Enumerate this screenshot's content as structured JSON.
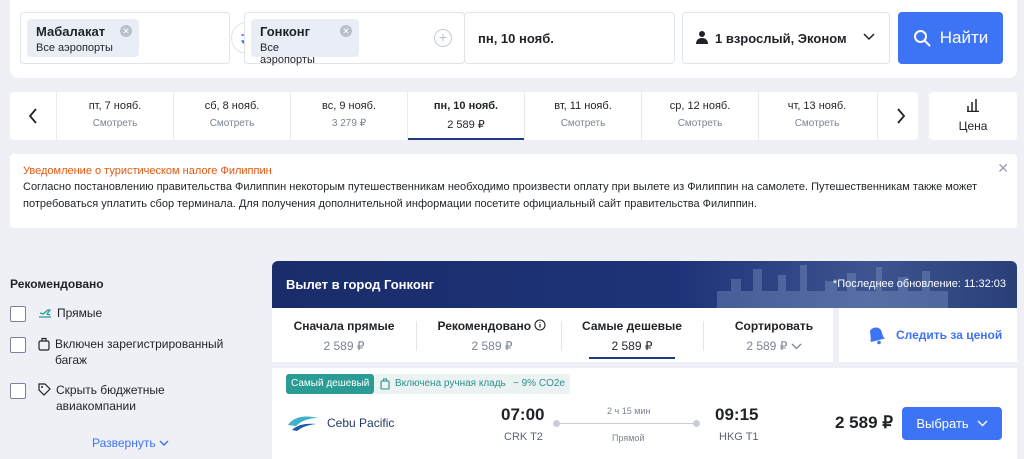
{
  "search": {
    "origin": {
      "city": "Мабалакат",
      "airports": "Все аэропорты"
    },
    "destination": {
      "city": "Гонконг",
      "airports": "Все аэропорты"
    },
    "date": "пн, 10 нояб.",
    "passengers": "1 взрослый, Эконом",
    "find_label": "Найти"
  },
  "date_strip": {
    "days": [
      {
        "date": "пт, 7 нояб.",
        "value": "Смотреть"
      },
      {
        "date": "сб, 8 нояб.",
        "value": "Смотреть"
      },
      {
        "date": "вс, 9 нояб.",
        "value": "3 279 ₽"
      },
      {
        "date": "пн, 10 нояб.",
        "value": "2 589 ₽",
        "selected": true
      },
      {
        "date": "вт, 11 нояб.",
        "value": "Смотреть"
      },
      {
        "date": "ср, 12 нояб.",
        "value": "Смотреть"
      },
      {
        "date": "чт, 13 нояб.",
        "value": "Смотреть"
      }
    ],
    "price_label": "Цена"
  },
  "notice": {
    "title": "Уведомление о туристическом налоге Филиппин",
    "body": "Согласно постановлению правительства Филиппин некоторым путешественникам необходимо произвести оплату при вылете из Филиппин на самолете. Путешественникам также может потребоваться уплатить сбор терминала. Для получения дополнительной информации посетите официальный сайт правительства Филиппин."
  },
  "sidebar": {
    "title": "Рекомендовано",
    "filters": [
      {
        "label": "Прямые",
        "icon": "direct-flight-icon"
      },
      {
        "label": "Включен зарегистрированный багаж",
        "icon": "luggage-icon"
      },
      {
        "label": "Скрыть бюджетные авиакомпании",
        "icon": "tag-icon"
      }
    ],
    "expand_label": "Развернуть"
  },
  "results": {
    "title": "Вылет в город Гонконг",
    "updated": "*Последнее обновление: 11:32:03",
    "sort_tabs": [
      {
        "name": "Сначала прямые",
        "value": "2 589 ₽"
      },
      {
        "name": "Рекомендовано",
        "value": "2 589 ₽"
      },
      {
        "name": "Самые дешевые",
        "value": "2 589 ₽",
        "selected": true
      },
      {
        "name": "Сортировать",
        "value": "2 589 ₽"
      }
    ],
    "track_label": "Следить за ценой"
  },
  "flight": {
    "badges": {
      "cheapest": "Самый дешевый",
      "bag": "Включена ручная кладь",
      "co2": "~ 9% CO2e"
    },
    "airline": "Cebu Pacific",
    "departure_time": "07:00",
    "departure_airport": "CRK T2",
    "arrival_time": "09:15",
    "arrival_airport": "HKG T1",
    "duration": "2 ч 15 мин",
    "stops": "Прямой",
    "price": "2 589 ₽",
    "select_label": "Выбрать"
  },
  "colors": {
    "accent": "#3d73f5",
    "navy": "#1f3a82",
    "notice_title": "#e4570f",
    "badge_green": "#2b9c94"
  }
}
